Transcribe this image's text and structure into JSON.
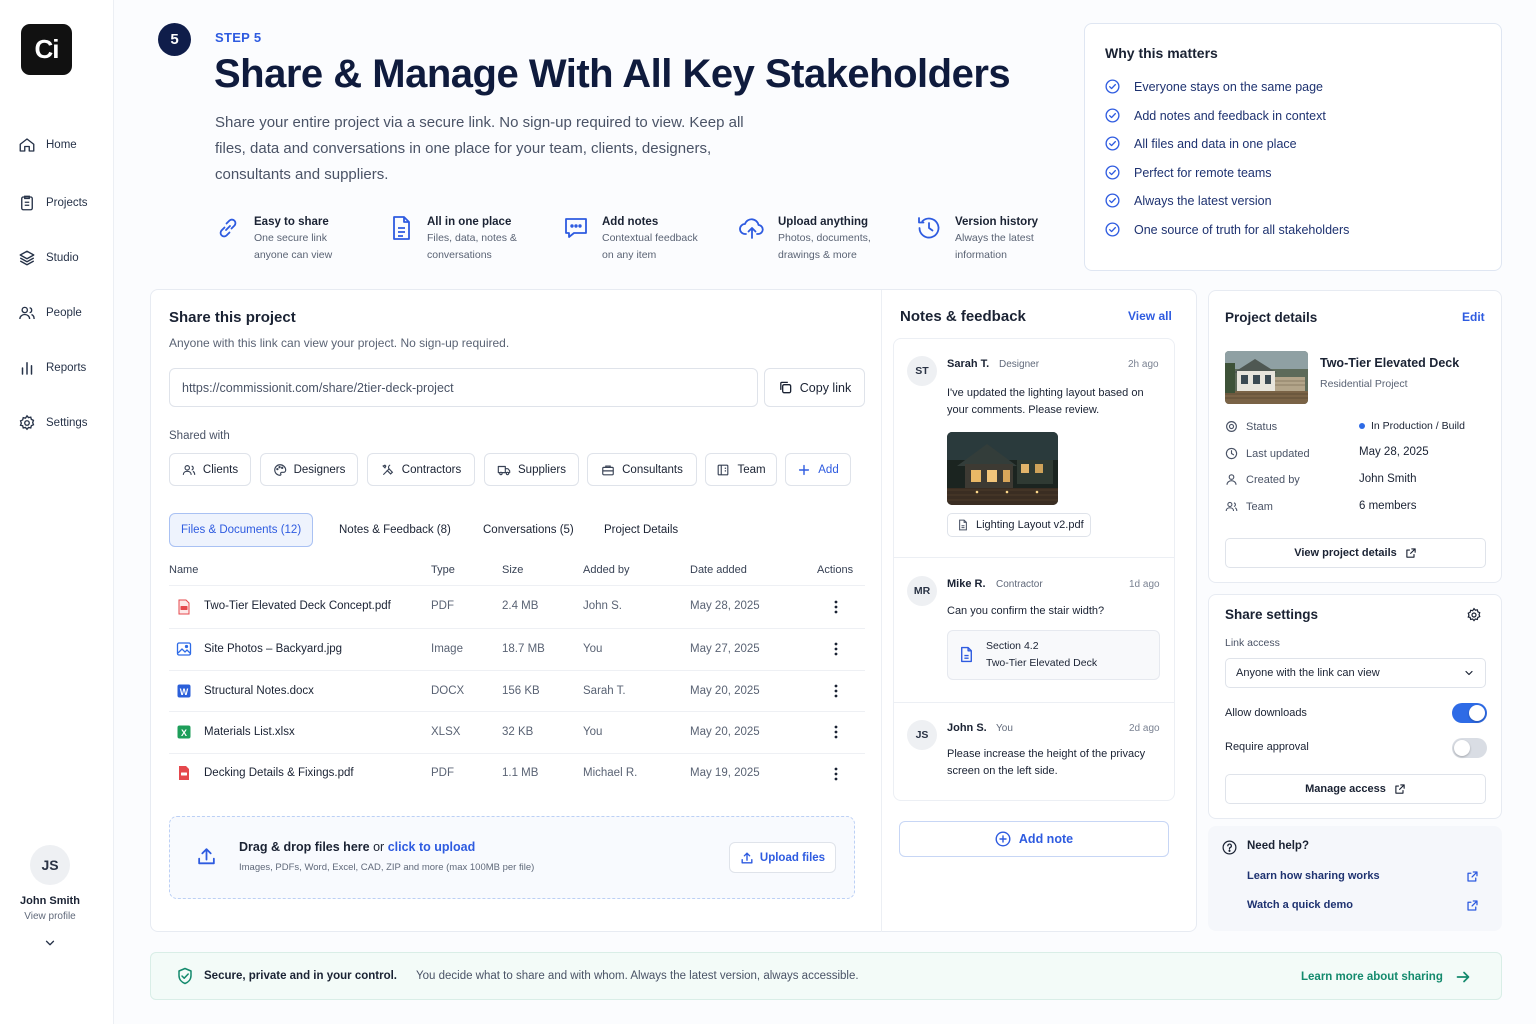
{
  "colors": {
    "accent": "#2e5be0",
    "navy": "#0f1b3d",
    "success": "#148a6d",
    "toggle_on": "#2e6be6"
  },
  "app": {
    "logo_text": "Ci"
  },
  "sidebar": {
    "items": [
      {
        "label": "Home",
        "icon": "home-icon"
      },
      {
        "label": "Projects",
        "icon": "clipboard-icon"
      },
      {
        "label": "Studio",
        "icon": "layers-icon"
      },
      {
        "label": "People",
        "icon": "people-icon"
      },
      {
        "label": "Reports",
        "icon": "bar-chart-icon"
      },
      {
        "label": "Settings",
        "icon": "gear-icon"
      }
    ],
    "user": {
      "initials": "JS",
      "name": "John Smith",
      "link": "View profile"
    }
  },
  "header": {
    "step_number": "5",
    "step_label": "STEP 5",
    "title": "Share & Manage With All Key Stakeholders",
    "subtitle": "Share your entire project via a secure link. No sign-up required to view. Keep all files, data and conversations in one place for your team, clients, designers, consultants and suppliers."
  },
  "features": [
    {
      "title": "Easy to share",
      "line1": "One secure link",
      "line2": "anyone can view",
      "icon": "link-icon"
    },
    {
      "title": "All in one place",
      "line1": "Files, data, notes &",
      "line2": "conversations",
      "icon": "document-icon"
    },
    {
      "title": "Add notes",
      "line1": "Contextual feedback",
      "line2": "on any item",
      "icon": "chat-icon"
    },
    {
      "title": "Upload anything",
      "line1": "Photos, documents,",
      "line2": "drawings & more",
      "icon": "cloud-upload-icon"
    },
    {
      "title": "Version history",
      "line1": "Always the latest",
      "line2": "information",
      "icon": "history-icon"
    }
  ],
  "why": {
    "title": "Why this matters",
    "items": [
      "Everyone stays on the same page",
      "Add notes and feedback in context",
      "All files and data in one place",
      "Perfect for remote teams",
      "Always the latest version",
      "One source of truth for all stakeholders"
    ]
  },
  "share": {
    "title": "Share this project",
    "subtitle": "Anyone with this link can view your project. No sign-up required.",
    "link": "https://commissionit.com/share/2tier-deck-project",
    "copy_label": "Copy link",
    "shared_with_label": "Shared with",
    "chips": [
      "Clients",
      "Designers",
      "Contractors",
      "Suppliers",
      "Consultants",
      "Team"
    ],
    "add_label": "Add"
  },
  "tabs": [
    "Files & Documents (12)",
    "Notes & Feedback (8)",
    "Conversations (5)",
    "Project Details"
  ],
  "files": {
    "headers": [
      "Name",
      "Type",
      "Size",
      "Added by",
      "Date added",
      "Actions"
    ],
    "rows": [
      {
        "name": "Two-Tier Elevated Deck Concept.pdf",
        "type": "PDF",
        "size": "2.4 MB",
        "added_by": "John S.",
        "date": "May 28, 2025",
        "icon": "pdf-icon"
      },
      {
        "name": "Site Photos – Backyard.jpg",
        "type": "Image",
        "size": "18.7 MB",
        "added_by": "You",
        "date": "May 27, 2025",
        "icon": "image-icon"
      },
      {
        "name": "Structural Notes.docx",
        "type": "DOCX",
        "size": "156 KB",
        "added_by": "Sarah T.",
        "date": "May 20, 2025",
        "icon": "word-icon"
      },
      {
        "name": "Materials List.xlsx",
        "type": "XLSX",
        "size": "32 KB",
        "added_by": "You",
        "date": "May 20, 2025",
        "icon": "excel-icon"
      },
      {
        "name": "Decking Details & Fixings.pdf",
        "type": "PDF",
        "size": "1.1 MB",
        "added_by": "Michael R.",
        "date": "May 19, 2025",
        "icon": "pdf-icon"
      }
    ]
  },
  "upload": {
    "drag_text": "Drag & drop files here",
    "or_text": "or",
    "click_text": "click to upload",
    "hint": "Images, PDFs, Word, Excel, CAD, ZIP and more (max 100MB per file)",
    "button": "Upload files"
  },
  "notes": {
    "title": "Notes & feedback",
    "view_all": "View all",
    "items": [
      {
        "initials": "ST",
        "name": "Sarah T.",
        "role": "Designer",
        "time": "2h ago",
        "line1": "I've updated the lighting layout based on",
        "line2": "your comments. Please review.",
        "attachment": "Lighting Layout v2.pdf"
      },
      {
        "initials": "MR",
        "name": "Mike R.",
        "role": "Contractor",
        "time": "1d ago",
        "line1": "Can you confirm the stair width?",
        "ref_title": "Section 4.2",
        "ref_sub": "Two-Tier Elevated Deck"
      },
      {
        "initials": "JS",
        "name": "John S.",
        "role": "You",
        "time": "2d ago",
        "line1": "Please increase the height of the privacy",
        "line2": "screen on the left side."
      }
    ],
    "add_label": "Add note"
  },
  "project": {
    "title": "Project details",
    "edit": "Edit",
    "name": "Two-Tier Elevated Deck",
    "type": "Residential Project",
    "rows": [
      {
        "label": "Status",
        "value": "In Production / Build",
        "icon": "status-icon"
      },
      {
        "label": "Last updated",
        "value": "May 28, 2025",
        "icon": "clock-icon"
      },
      {
        "label": "Created by",
        "value": "John Smith",
        "icon": "user-icon"
      },
      {
        "label": "Team",
        "value": "6 members",
        "icon": "team-icon"
      }
    ],
    "view_button": "View project details"
  },
  "share_settings": {
    "title": "Share settings",
    "link_access_label": "Link access",
    "link_access_value": "Anyone with the link can view",
    "allow_downloads": "Allow downloads",
    "allow_downloads_on": true,
    "require_approval": "Require approval",
    "require_approval_on": false,
    "manage_button": "Manage access"
  },
  "help": {
    "title": "Need help?",
    "links": [
      "Learn how sharing works",
      "Watch a quick demo"
    ]
  },
  "footer": {
    "strong": "Secure, private and in your control.",
    "text": "You decide what to share and with whom. Always the latest version, always accessible.",
    "link": "Learn more about sharing"
  }
}
